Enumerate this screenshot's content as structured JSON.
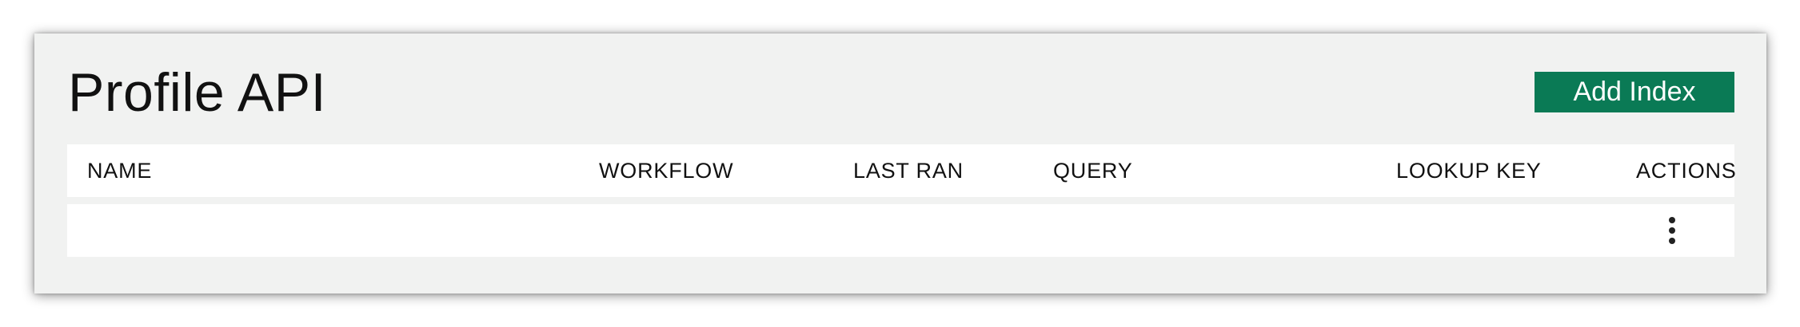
{
  "header": {
    "title": "Profile API",
    "add_button_label": "Add Index"
  },
  "table": {
    "columns": [
      "NAME",
      "WORKFLOW",
      "LAST RAN",
      "QUERY",
      "LOOKUP KEY",
      "ACTIONS"
    ],
    "rows": [
      {
        "name": "",
        "workflow": "",
        "last_ran": "",
        "query": "",
        "lookup_key": "",
        "actions_icon": "more-vertical-icon"
      }
    ]
  },
  "colors": {
    "accent": "#0a7a55",
    "card_background": "#f1f2f1",
    "table_background": "#ffffff"
  }
}
